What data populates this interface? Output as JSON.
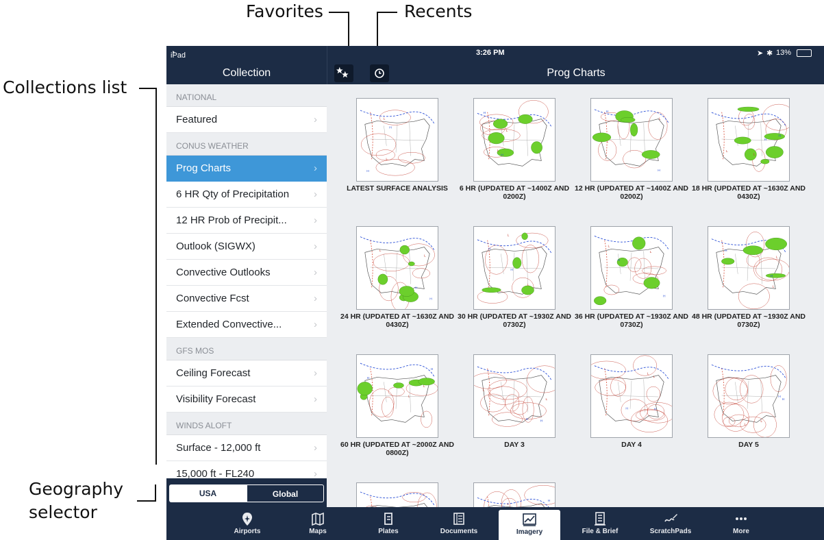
{
  "callouts": {
    "favorites": "Favorites",
    "recents": "Recents",
    "collections_list": "Collections list",
    "geography_selector_line1": "Geography",
    "geography_selector_line2": "selector"
  },
  "status_bar": {
    "device": "iPad",
    "time": "3:26 PM",
    "battery": "13%"
  },
  "sidebar": {
    "title": "Collection",
    "rows": [
      {
        "type": "section",
        "label": "NATIONAL"
      },
      {
        "type": "item",
        "label": "Featured"
      },
      {
        "type": "section",
        "label": "CONUS WEATHER"
      },
      {
        "type": "item",
        "label": "Prog Charts",
        "selected": true
      },
      {
        "type": "item",
        "label": "6 HR Qty of Precipitation"
      },
      {
        "type": "item",
        "label": "12 HR Prob of Precipit..."
      },
      {
        "type": "item",
        "label": "Outlook (SIGWX)"
      },
      {
        "type": "item",
        "label": "Convective Outlooks"
      },
      {
        "type": "item",
        "label": "Convective Fcst"
      },
      {
        "type": "item",
        "label": "Extended Convective..."
      },
      {
        "type": "section",
        "label": "GFS MOS"
      },
      {
        "type": "item",
        "label": "Ceiling Forecast"
      },
      {
        "type": "item",
        "label": "Visibility Forecast"
      },
      {
        "type": "section",
        "label": "WINDS ALOFT"
      },
      {
        "type": "item",
        "label": "Surface - 12,000 ft"
      },
      {
        "type": "item",
        "label": "15,000 ft - FL240"
      }
    ],
    "geography": {
      "options": [
        "USA",
        "Global"
      ],
      "selected": "USA"
    }
  },
  "main": {
    "title": "Prog Charts",
    "favorites_icon": "stars-icon",
    "recents_icon": "clock-icon",
    "charts": [
      {
        "label": "LATEST SURFACE ANALYSIS",
        "style": "surface"
      },
      {
        "label": "6 HR (UPDATED AT ~1400Z AND 0200Z)",
        "style": "precip"
      },
      {
        "label": "12 HR (UPDATED AT ~1400Z AND 0200Z)",
        "style": "precip"
      },
      {
        "label": "18 HR (UPDATED AT ~1630Z AND 0430Z)",
        "style": "precip"
      },
      {
        "label": "24 HR (UPDATED AT ~1630Z AND 0430Z)",
        "style": "precip"
      },
      {
        "label": "30 HR (UPDATED AT ~1930Z AND 0730Z)",
        "style": "precip"
      },
      {
        "label": "36 HR (UPDATED AT ~1930Z AND 0730Z)",
        "style": "precip"
      },
      {
        "label": "48 HR (UPDATED AT ~1930Z AND 0730Z)",
        "style": "precip"
      },
      {
        "label": "60 HR (UPDATED AT ~2000Z AND 0800Z)",
        "style": "precip"
      },
      {
        "label": "DAY 3",
        "style": "isobar"
      },
      {
        "label": "DAY 4",
        "style": "isobar"
      },
      {
        "label": "DAY 5",
        "style": "isobar"
      },
      {
        "label": "",
        "style": "isobar"
      },
      {
        "label": "",
        "style": "isobar"
      }
    ]
  },
  "tabs": [
    {
      "label": "Airports",
      "icon": "airport-pin-icon"
    },
    {
      "label": "Maps",
      "icon": "map-icon"
    },
    {
      "label": "Plates",
      "icon": "plates-icon"
    },
    {
      "label": "Documents",
      "icon": "documents-icon"
    },
    {
      "label": "Imagery",
      "icon": "imagery-chart-icon",
      "active": true
    },
    {
      "label": "File & Brief",
      "icon": "file-brief-icon"
    },
    {
      "label": "ScratchPads",
      "icon": "scratchpad-pen-icon"
    },
    {
      "label": "More",
      "icon": "more-dots-icon"
    }
  ],
  "colors": {
    "nav": "#1c2c45",
    "selected_row": "#3e97d8",
    "precip_green": "#6ccf2c",
    "isobar_red": "#c0392b",
    "front_blue": "#2a4fd6"
  }
}
